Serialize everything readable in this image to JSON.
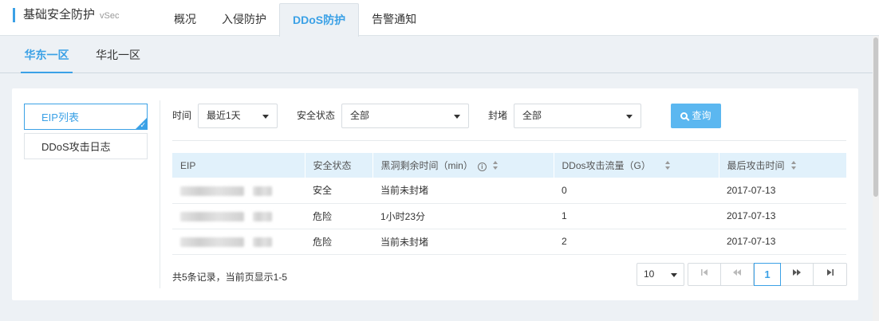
{
  "brand": {
    "title": "基础安全防护",
    "sub": "vSec"
  },
  "main_tabs": [
    {
      "label": "概况"
    },
    {
      "label": "入侵防护"
    },
    {
      "label": "DDoS防护"
    },
    {
      "label": "告警通知"
    }
  ],
  "region_tabs": [
    {
      "label": "华东一区"
    },
    {
      "label": "华北一区"
    }
  ],
  "left_nav": [
    {
      "label": "EIP列表"
    },
    {
      "label": "DDoS攻击日志"
    }
  ],
  "filters": {
    "time_label": "时间",
    "time_value": "最近1天",
    "status_label": "安全状态",
    "status_value": "全部",
    "block_label": "封堵",
    "block_value": "全部",
    "query_label": "查询"
  },
  "table": {
    "headers": [
      "EIP",
      "安全状态",
      "黑洞剩余时间（min）",
      "DDos攻击流量（G）",
      "最后攻击时间"
    ],
    "rows": [
      {
        "eip": "",
        "status": "安全",
        "blackhole": "当前未封堵",
        "traffic": "0",
        "last_attack": "2017-07-13"
      },
      {
        "eip": "",
        "status": "危险",
        "blackhole": "1小时23分",
        "traffic": "1",
        "last_attack": "2017-07-13"
      },
      {
        "eip": "",
        "status": "危险",
        "blackhole": "当前未封堵",
        "traffic": "2",
        "last_attack": "2017-07-13"
      }
    ]
  },
  "footer": {
    "summary": "共5条记录，当前页显示1-5",
    "page_size": "10",
    "current_page": "1"
  },
  "colors": {
    "accent": "#3ba1e6",
    "safe": "#1a8f2c",
    "danger": "#e0483e",
    "header_bg": "#e1f1fb"
  }
}
